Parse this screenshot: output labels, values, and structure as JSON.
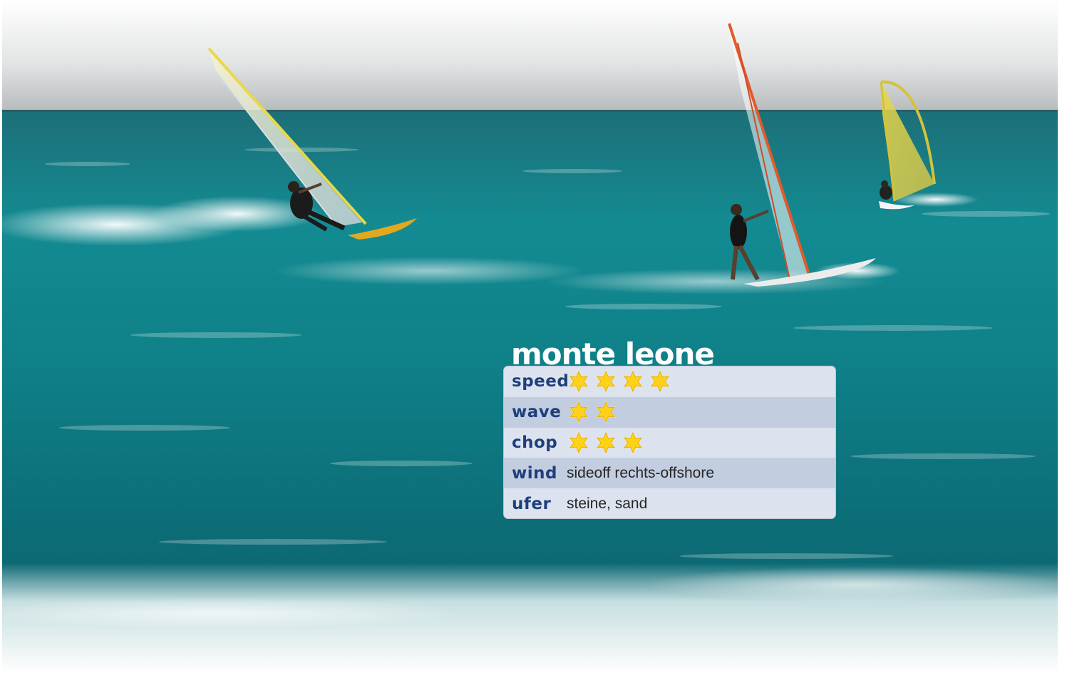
{
  "spot": {
    "name": "monte leone",
    "ratings": [
      {
        "label": "speed",
        "stars": 4
      },
      {
        "label": "wave",
        "stars": 2
      },
      {
        "label": "chop",
        "stars": 3
      }
    ],
    "details": [
      {
        "label": "wind",
        "value": "sideoff rechts-offshore"
      },
      {
        "label": "ufer",
        "value": "steine, sand"
      }
    ]
  },
  "colors": {
    "label_text": "#1f3f7c",
    "row_light": "#dde3ee",
    "row_dark": "#c2cde0",
    "star_fill": "#ffd21a",
    "sea": "#0f7e86",
    "sky": "#dfe2e2"
  },
  "icons": {
    "rating": "star-icon"
  }
}
